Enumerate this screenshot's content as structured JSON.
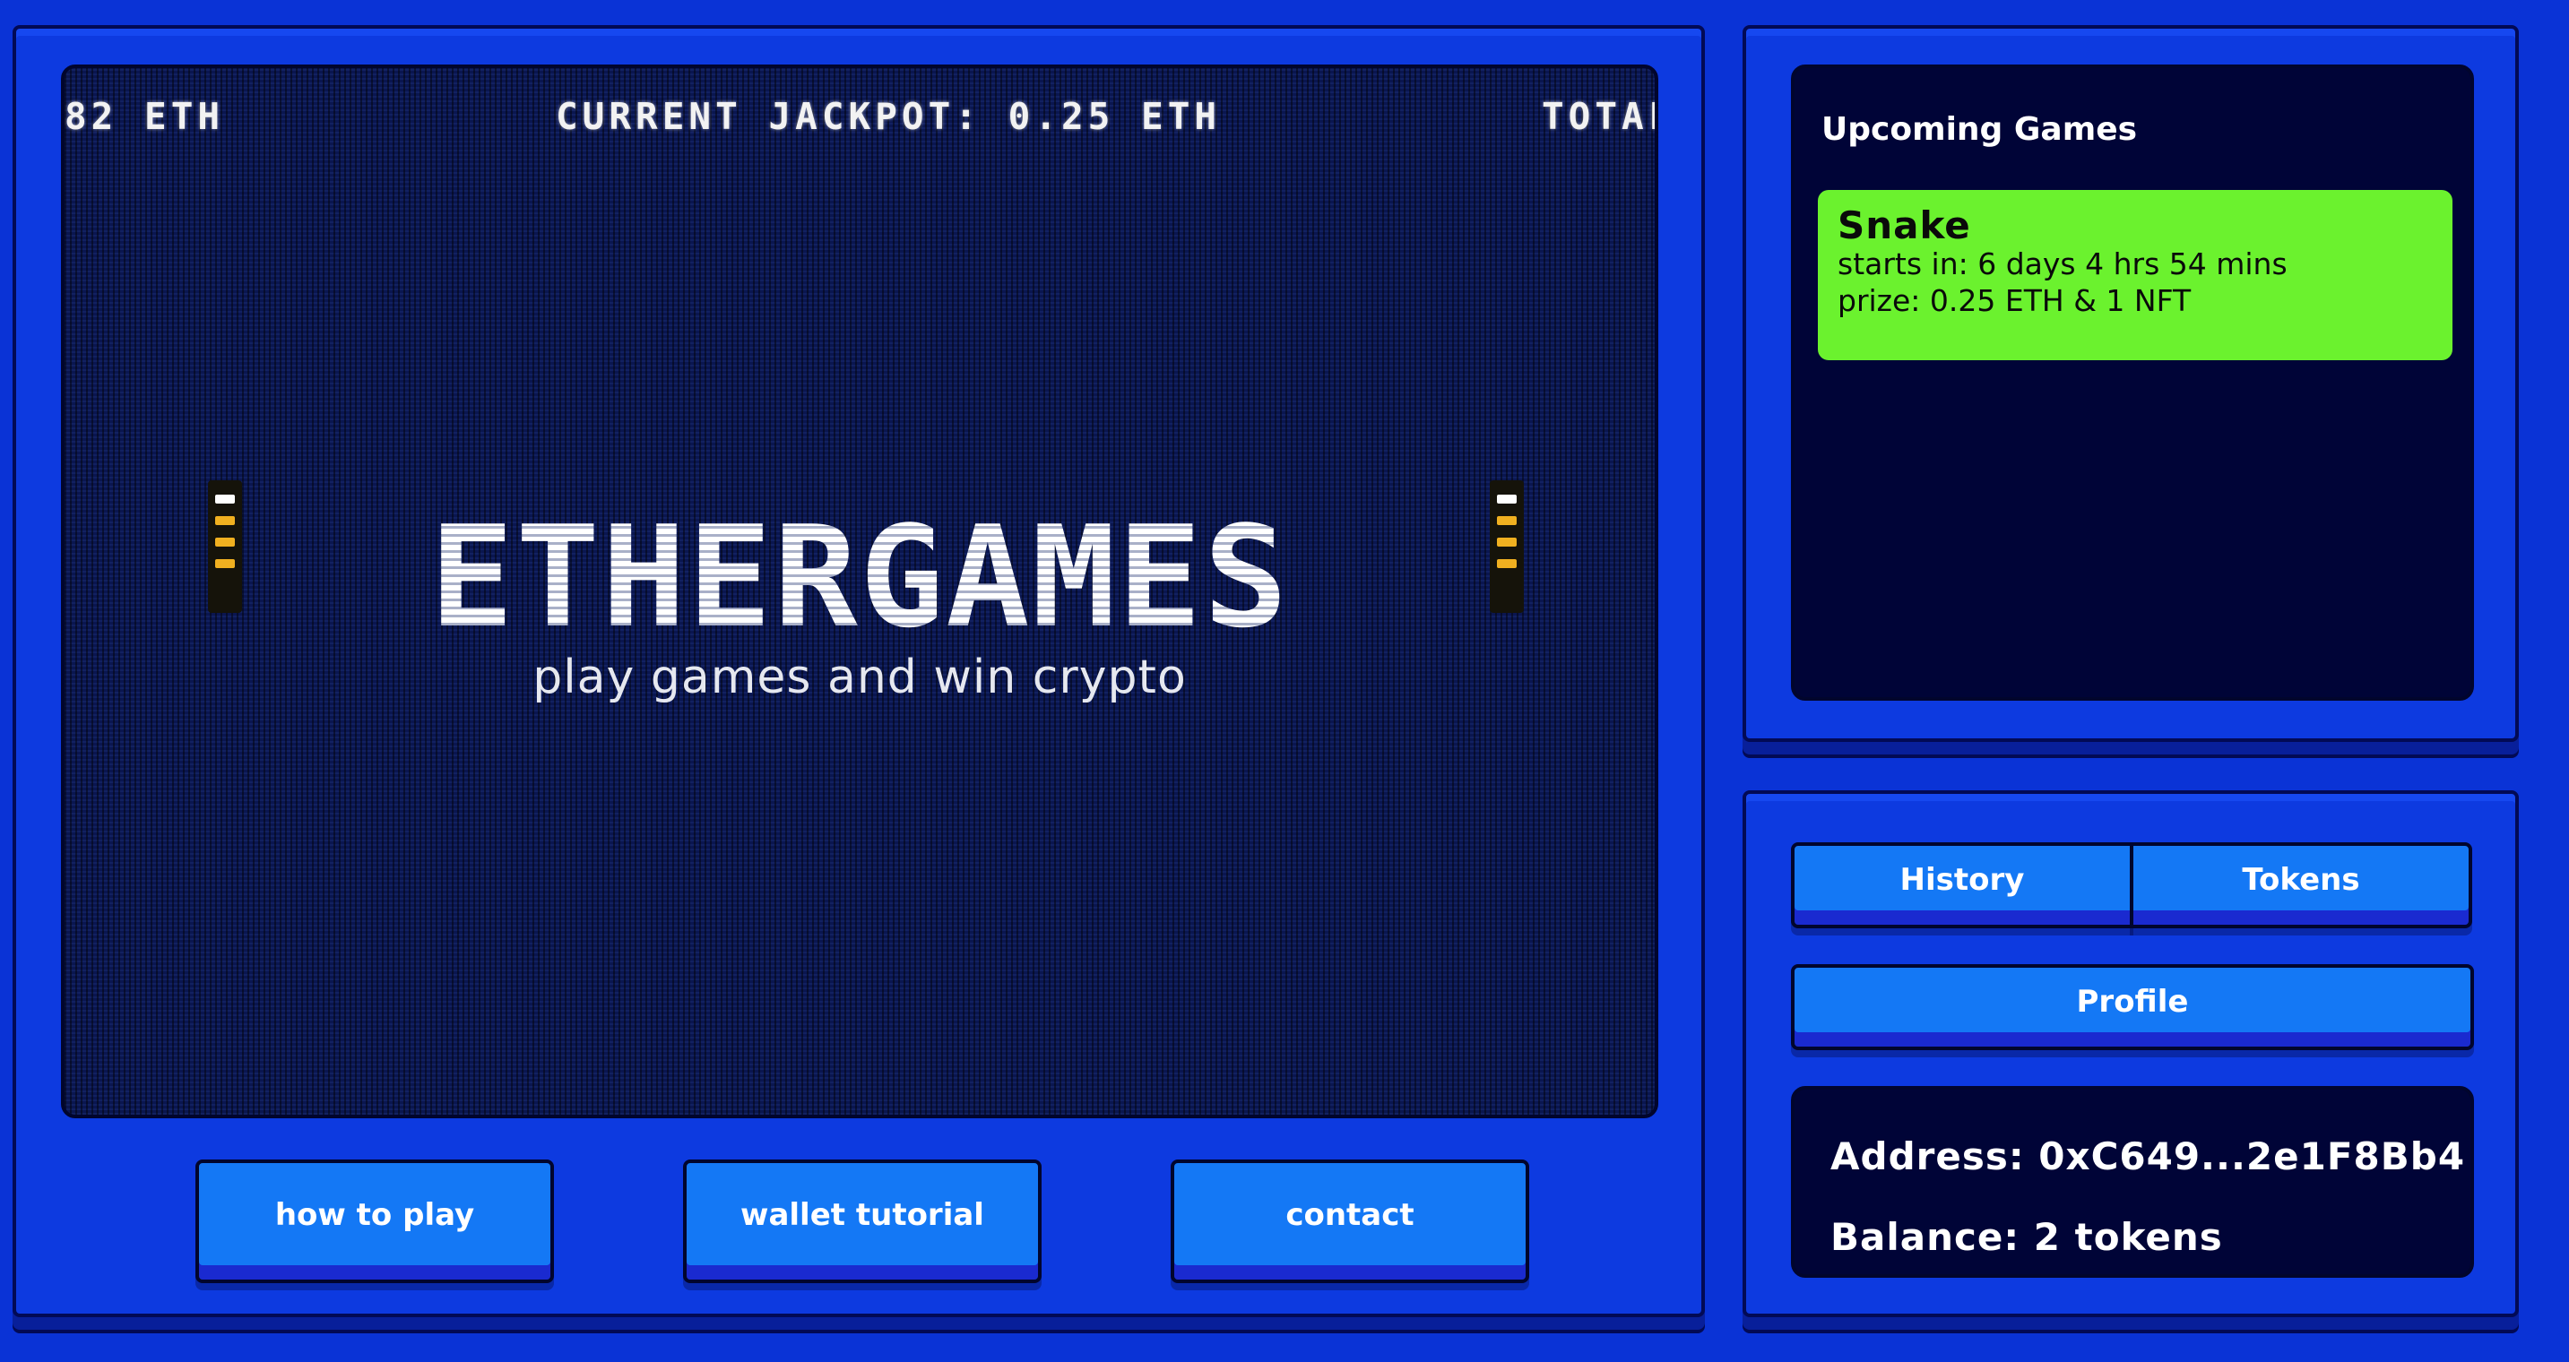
{
  "colors": {
    "page_bg": "#0a33d6",
    "panel": "#0d3ae0",
    "screen": "#0a1650",
    "button": "#1478f5",
    "card_green": "#6bf22e"
  },
  "ticker": {
    "left": "82 ETH",
    "center": "CURRENT JACKPOT: 0.25 ETH",
    "right": "TOTAL"
  },
  "hero": {
    "title": "ETHERGAMES",
    "subtitle": "play games and win crypto"
  },
  "bottom_nav": {
    "how_to_play": "how to play",
    "wallet_tutorial": "wallet tutorial",
    "contact": "contact"
  },
  "upcoming": {
    "title": "Upcoming Games",
    "games": [
      {
        "name": "Snake",
        "starts": "starts in: 6 days 4 hrs 54 mins",
        "prize": "prize: 0.25 ETH & 1 NFT"
      }
    ]
  },
  "account": {
    "tabs": {
      "history": "History",
      "tokens": "Tokens",
      "profile": "Profile"
    },
    "address": "Address: 0xC649...2e1F8Bb4",
    "balance": "Balance: 2 tokens"
  }
}
